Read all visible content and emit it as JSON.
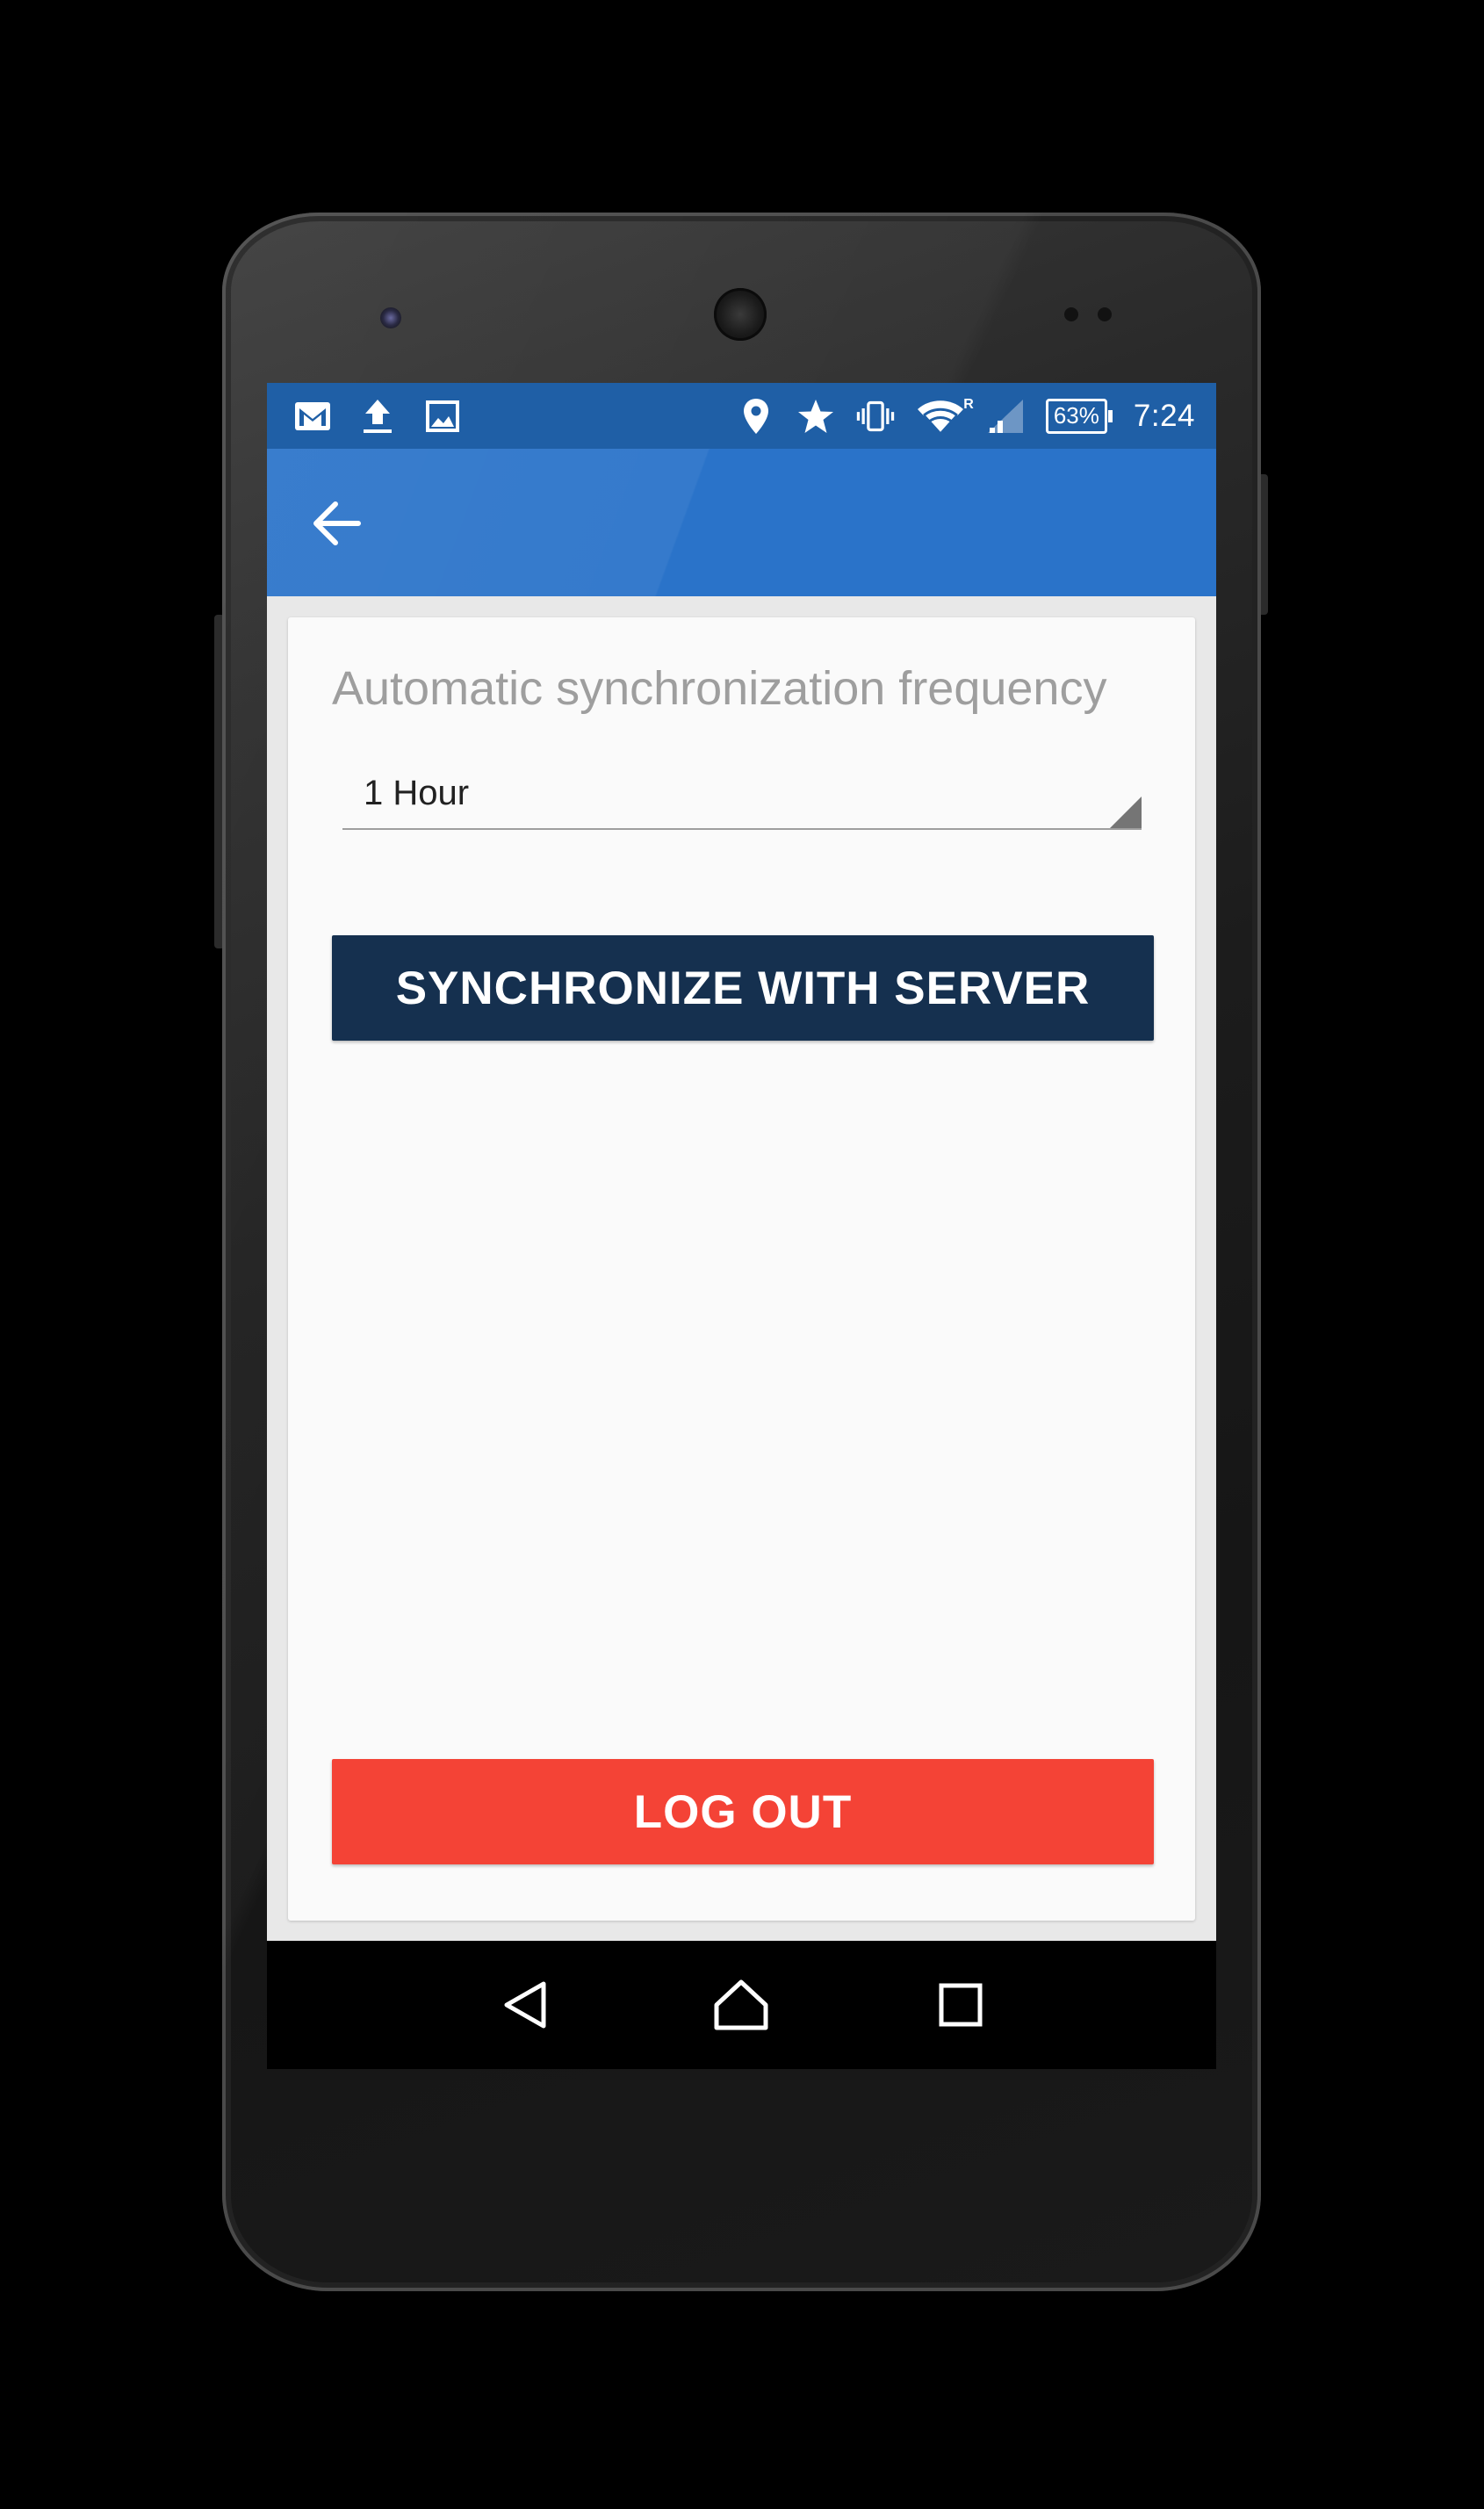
{
  "status_bar": {
    "left_icons": [
      "gmail-icon",
      "upload-icon",
      "image-icon"
    ],
    "right_icons": [
      "location-icon",
      "star-icon",
      "vibrate-icon",
      "wifi-icon",
      "cell-signal-icon"
    ],
    "roaming_label": "R",
    "battery_percent": "63%",
    "time": "7:24"
  },
  "toolbar": {
    "back_icon": "arrow-back-icon"
  },
  "settings": {
    "frequency_label": "Automatic synchronization frequency",
    "frequency_value": "1 Hour",
    "sync_button_label": "SYNCHRONIZE WITH SERVER",
    "logout_button_label": "LOG OUT"
  },
  "nav_bar": {
    "icons": [
      "back-triangle-icon",
      "home-icon",
      "recents-icon"
    ]
  },
  "colors": {
    "status_bar": "#1f5fa6",
    "toolbar": "#2a73c9",
    "sync_button": "#15304f",
    "logout_button": "#f44336",
    "card_background": "#fafafa"
  }
}
